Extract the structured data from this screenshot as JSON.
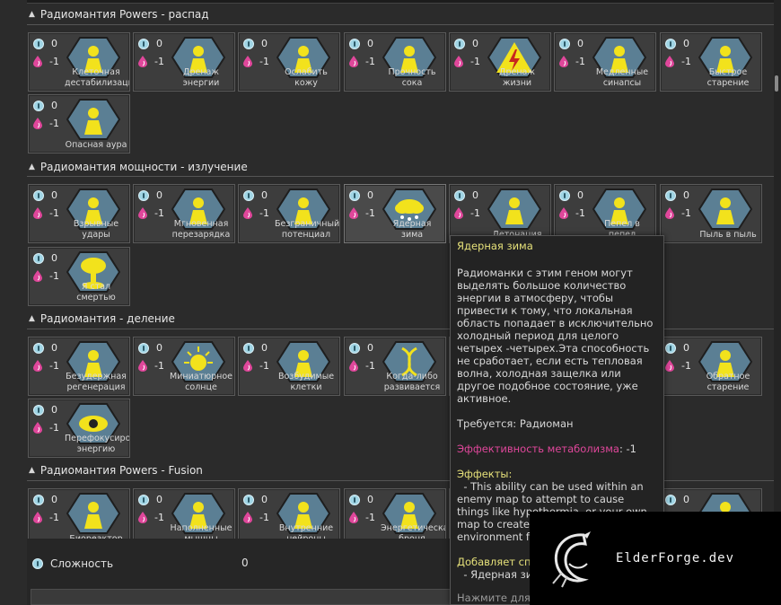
{
  "sections": [
    {
      "title": "Радиомантия Powers - распад",
      "cards": [
        {
          "label": "Клеточная дестабилизация",
          "complexity": "0",
          "metabolism": "-1",
          "icon": "cell-burst-icon"
        },
        {
          "label": "Дренаж энергии",
          "complexity": "0",
          "metabolism": "-1",
          "icon": "hand-drain-icon"
        },
        {
          "label": "Ослабить кожу",
          "complexity": "0",
          "metabolism": "-1",
          "icon": "figure-shock-icon"
        },
        {
          "label": "Прочность сока",
          "complexity": "0",
          "metabolism": "-1",
          "icon": "beast-icon"
        },
        {
          "label": "Дренаж жизни",
          "complexity": "0",
          "metabolism": "-1",
          "icon": "lightning-sign-icon"
        },
        {
          "label": "Медленные синапсы",
          "complexity": "0",
          "metabolism": "-1",
          "icon": "synapse-icon"
        },
        {
          "label": "Быстрое старение",
          "complexity": "0",
          "metabolism": "-1",
          "icon": "falling-figure-icon"
        },
        {
          "label": "Опасная аура",
          "complexity": "0",
          "metabolism": "-1",
          "icon": "radiating-figure-icon"
        }
      ]
    },
    {
      "title": "Радиомантия мощности - излучение",
      "cards": [
        {
          "label": "Взрывные удары",
          "complexity": "0",
          "metabolism": "-1",
          "icon": "explosive-punch-icon"
        },
        {
          "label": "Мгновенная перезарядка",
          "complexity": "0",
          "metabolism": "-1",
          "icon": "recharge-icon"
        },
        {
          "label": "Безграничный потенциал",
          "complexity": "0",
          "metabolism": "-1",
          "icon": "silhouette-icon"
        },
        {
          "label": "Ядерная зима",
          "complexity": "0",
          "metabolism": "-1",
          "icon": "snow-cloud-icon"
        },
        {
          "label": "Детонация",
          "complexity": "0",
          "metabolism": "-1",
          "icon": "detonation-icon"
        },
        {
          "label": "Пепел в пепел",
          "complexity": "0",
          "metabolism": "-1",
          "icon": "ash-icon"
        },
        {
          "label": "Пыль в пыль",
          "complexity": "0",
          "metabolism": "-1",
          "icon": "dust-swirl-icon"
        },
        {
          "label": "Я стал смертью",
          "complexity": "0",
          "metabolism": "-1",
          "icon": "mushroom-cloud-icon"
        }
      ]
    },
    {
      "title": "Радиомантия - деление",
      "cards": [
        {
          "label": "Безудержная регенерация",
          "complexity": "0",
          "metabolism": "-1",
          "icon": "regeneration-icon"
        },
        {
          "label": "Миниатюрное солнце",
          "complexity": "0",
          "metabolism": "-1",
          "icon": "mini-sun-icon"
        },
        {
          "label": "Возбудимые клетки",
          "complexity": "0",
          "metabolism": "-1",
          "icon": "excited-cells-icon"
        },
        {
          "label": "Когда-либо развивается",
          "complexity": "0",
          "metabolism": "-1",
          "icon": "dna-icon"
        },
        {
          "label": "",
          "complexity": "0",
          "metabolism": "-1",
          "icon": "hidden-icon"
        },
        {
          "label": "",
          "complexity": "0",
          "metabolism": "-1",
          "icon": "hidden-icon"
        },
        {
          "label": "Обратное старение",
          "complexity": "0",
          "metabolism": "-1",
          "icon": "muscle-figure-icon"
        },
        {
          "label": "Перефокусировать энергию",
          "complexity": "0",
          "metabolism": "-1",
          "icon": "eye-icon"
        }
      ]
    },
    {
      "title": "Радиомантия Powers - Fusion",
      "cards": [
        {
          "label": "Биореактор",
          "complexity": "0",
          "metabolism": "-1",
          "icon": "bioreactor-icon"
        },
        {
          "label": "Наполненные мышцы",
          "complexity": "0",
          "metabolism": "-1",
          "icon": "muscle-arm-icon"
        },
        {
          "label": "Внутренние нейроны",
          "complexity": "0",
          "metabolism": "-1",
          "icon": "neurons-icon"
        },
        {
          "label": "Энергетическая броня",
          "complexity": "0",
          "metabolism": "-1",
          "icon": "energy-armor-icon"
        },
        {
          "label": "",
          "complexity": "0",
          "metabolism": "-1",
          "icon": "hidden-icon"
        },
        {
          "label": "",
          "complexity": "0",
          "metabolism": "-1",
          "icon": "hidden-icon"
        },
        {
          "label": "",
          "complexity": "0",
          "metabolism": "-1",
          "icon": "spark-icon"
        }
      ]
    }
  ],
  "footer": {
    "complexity_label": "Сложность",
    "complexity_value": "0"
  },
  "tooltip": {
    "title": "Ядерная зима",
    "description": "Радиоманки с этим геном могут выделять большое количество энергии в атмосферу, чтобы привести к тому, что локальная область попадает в исключительно холодный период для целого четырех -четырех.Эта способность не сработает, если есть тепловая волна, холодная защелка или другое подобное состояние, уже активное.",
    "requires": "Требуется: Радиоман",
    "metabolism_label": "Эффективность метаболизма",
    "metabolism_value": ": -1",
    "effects_header": "Эффекты:",
    "effects_text": "  - This ability can be used within an enemy map to attempt to cause things like hypothermia, or your own map to create a naturally cold environment for a time.",
    "adds_header": "Добавляет способность:",
    "adds_text": "  - Ядерная зима",
    "click_hint": "Нажмите для деталей"
  },
  "watermark": {
    "text": "ElderForge.dev"
  },
  "colors": {
    "background": "#2b2b2b",
    "card": "#3d3d3d",
    "hex_fill": "#5b7f94",
    "icon_yellow": "#f2e21c",
    "complexity_blue": "#9fd4e4",
    "metabolism_pink": "#e0479b",
    "tooltip_title": "#e6e17a"
  }
}
